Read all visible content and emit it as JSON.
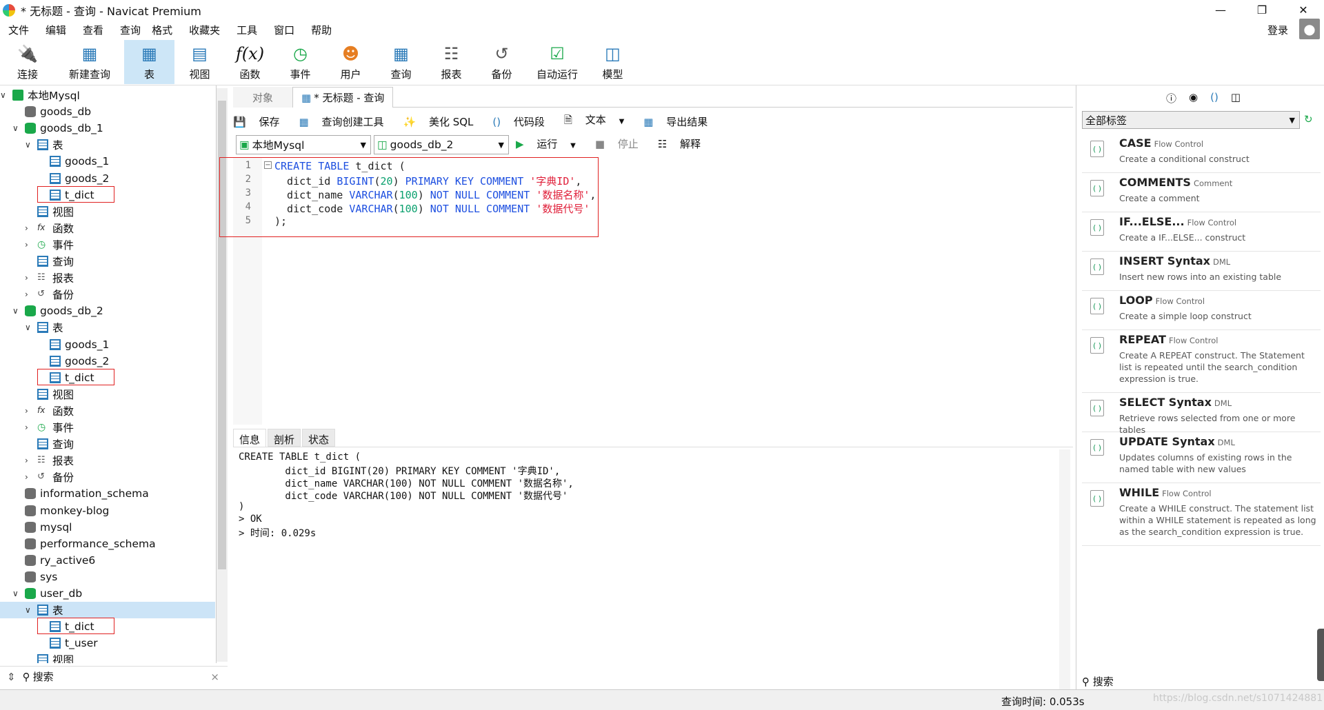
{
  "window": {
    "title": "* 无标题 - 查询 - Navicat Premium"
  },
  "menu": [
    "文件",
    "编辑",
    "查看",
    "查询",
    "格式",
    "收藏夹",
    "工具",
    "窗口",
    "帮助"
  ],
  "login": "登录",
  "toolbar": [
    {
      "label": "连接",
      "icon": "plug-icon"
    },
    {
      "label": "新建查询",
      "icon": "new-query-icon"
    },
    {
      "label": "表",
      "icon": "table-icon"
    },
    {
      "label": "视图",
      "icon": "view-icon"
    },
    {
      "label": "函数",
      "icon": "function-icon"
    },
    {
      "label": "事件",
      "icon": "clock-icon"
    },
    {
      "label": "用户",
      "icon": "user-icon"
    },
    {
      "label": "查询",
      "icon": "query-icon"
    },
    {
      "label": "报表",
      "icon": "report-icon"
    },
    {
      "label": "备份",
      "icon": "backup-icon"
    },
    {
      "label": "自动运行",
      "icon": "autorun-icon"
    },
    {
      "label": "模型",
      "icon": "model-icon"
    }
  ],
  "tree": [
    {
      "label": "本地Mysql",
      "level": 0,
      "kind": "connection",
      "expanded": true
    },
    {
      "label": "goods_db",
      "level": 1,
      "kind": "db-gray"
    },
    {
      "label": "goods_db_1",
      "level": 1,
      "kind": "db-green",
      "expanded": true
    },
    {
      "label": "表",
      "level": 2,
      "kind": "folder-table",
      "expanded": true
    },
    {
      "label": "goods_1",
      "level": 3,
      "kind": "table"
    },
    {
      "label": "goods_2",
      "level": 3,
      "kind": "table"
    },
    {
      "label": "t_dict",
      "level": 3,
      "kind": "table",
      "highlight": true
    },
    {
      "label": "视图",
      "level": 2,
      "kind": "view"
    },
    {
      "label": "函数",
      "level": 2,
      "kind": "func",
      "collapsed": true
    },
    {
      "label": "事件",
      "level": 2,
      "kind": "event",
      "collapsed": true
    },
    {
      "label": "查询",
      "level": 2,
      "kind": "query"
    },
    {
      "label": "报表",
      "level": 2,
      "kind": "report",
      "collapsed": true
    },
    {
      "label": "备份",
      "level": 2,
      "kind": "backup",
      "collapsed": true
    },
    {
      "label": "goods_db_2",
      "level": 1,
      "kind": "db-green",
      "expanded": true
    },
    {
      "label": "表",
      "level": 2,
      "kind": "folder-table",
      "expanded": true
    },
    {
      "label": "goods_1",
      "level": 3,
      "kind": "table"
    },
    {
      "label": "goods_2",
      "level": 3,
      "kind": "table"
    },
    {
      "label": "t_dict",
      "level": 3,
      "kind": "table",
      "highlight": true
    },
    {
      "label": "视图",
      "level": 2,
      "kind": "view"
    },
    {
      "label": "函数",
      "level": 2,
      "kind": "func",
      "collapsed": true
    },
    {
      "label": "事件",
      "level": 2,
      "kind": "event",
      "collapsed": true
    },
    {
      "label": "查询",
      "level": 2,
      "kind": "query"
    },
    {
      "label": "报表",
      "level": 2,
      "kind": "report",
      "collapsed": true
    },
    {
      "label": "备份",
      "level": 2,
      "kind": "backup",
      "collapsed": true
    },
    {
      "label": "information_schema",
      "level": 1,
      "kind": "db-gray"
    },
    {
      "label": "monkey-blog",
      "level": 1,
      "kind": "db-gray"
    },
    {
      "label": "mysql",
      "level": 1,
      "kind": "db-gray"
    },
    {
      "label": "performance_schema",
      "level": 1,
      "kind": "db-gray"
    },
    {
      "label": "ry_active6",
      "level": 1,
      "kind": "db-gray"
    },
    {
      "label": "sys",
      "level": 1,
      "kind": "db-gray"
    },
    {
      "label": "user_db",
      "level": 1,
      "kind": "db-green",
      "expanded": true
    },
    {
      "label": "表",
      "level": 2,
      "kind": "folder-table",
      "expanded": true,
      "selected": true
    },
    {
      "label": "t_dict",
      "level": 3,
      "kind": "table",
      "highlight": true
    },
    {
      "label": "t_user",
      "level": 3,
      "kind": "table"
    },
    {
      "label": "视图",
      "level": 2,
      "kind": "view"
    }
  ],
  "tree_search": "搜索",
  "tabs": {
    "objects": "对象",
    "query": "* 无标题 - 查询"
  },
  "query_toolbar": [
    "保存",
    "查询创建工具",
    "美化 SQL",
    "代码段",
    "文本",
    "导出结果"
  ],
  "connection_select": "本地Mysql",
  "database_select": "goods_db_2",
  "run_bar": [
    "运行",
    "停止",
    "解释"
  ],
  "editor_lines": [
    "1",
    "2",
    "3",
    "4",
    "5"
  ],
  "result_tabs": [
    "信息",
    "剖析",
    "状态"
  ],
  "result_lines": [
    "CREATE TABLE t_dict (",
    "        dict_id BIGINT(20) PRIMARY KEY COMMENT '字典ID',",
    "        dict_name VARCHAR(100) NOT NULL COMMENT '数据名称',",
    "        dict_code VARCHAR(100) NOT NULL COMMENT '数据代号'",
    ")",
    "> OK",
    "> 时间: 0.029s"
  ],
  "right_panel": {
    "filter": "全部标签",
    "search": "搜索",
    "snippets": [
      {
        "name": "CASE",
        "tag": "Flow Control",
        "desc": "Create a conditional construct"
      },
      {
        "name": "COMMENTS",
        "tag": "Comment",
        "desc": "Create a comment"
      },
      {
        "name": "IF...ELSE...",
        "tag": "Flow Control",
        "desc": "Create a IF...ELSE... construct"
      },
      {
        "name": "INSERT Syntax",
        "tag": "DML",
        "desc": "Insert new rows into an existing table"
      },
      {
        "name": "LOOP",
        "tag": "Flow Control",
        "desc": "Create a simple loop construct"
      },
      {
        "name": "REPEAT",
        "tag": "Flow Control",
        "desc": "Create A REPEAT construct. The Statement list is repeated until the search_condition expression is true."
      },
      {
        "name": "SELECT Syntax",
        "tag": "DML",
        "desc": "Retrieve rows selected from one or more tables"
      },
      {
        "name": "UPDATE Syntax",
        "tag": "DML",
        "desc": "Updates columns of existing rows in the named table with new values"
      },
      {
        "name": "WHILE",
        "tag": "Flow Control",
        "desc": "Create a WHILE construct. The statement list within a WHILE statement is repeated as long as the search_condition expression is true."
      }
    ]
  },
  "status": {
    "query_time": "查询时间: 0.053s",
    "watermark": "https://blog.csdn.net/s1071424881"
  }
}
